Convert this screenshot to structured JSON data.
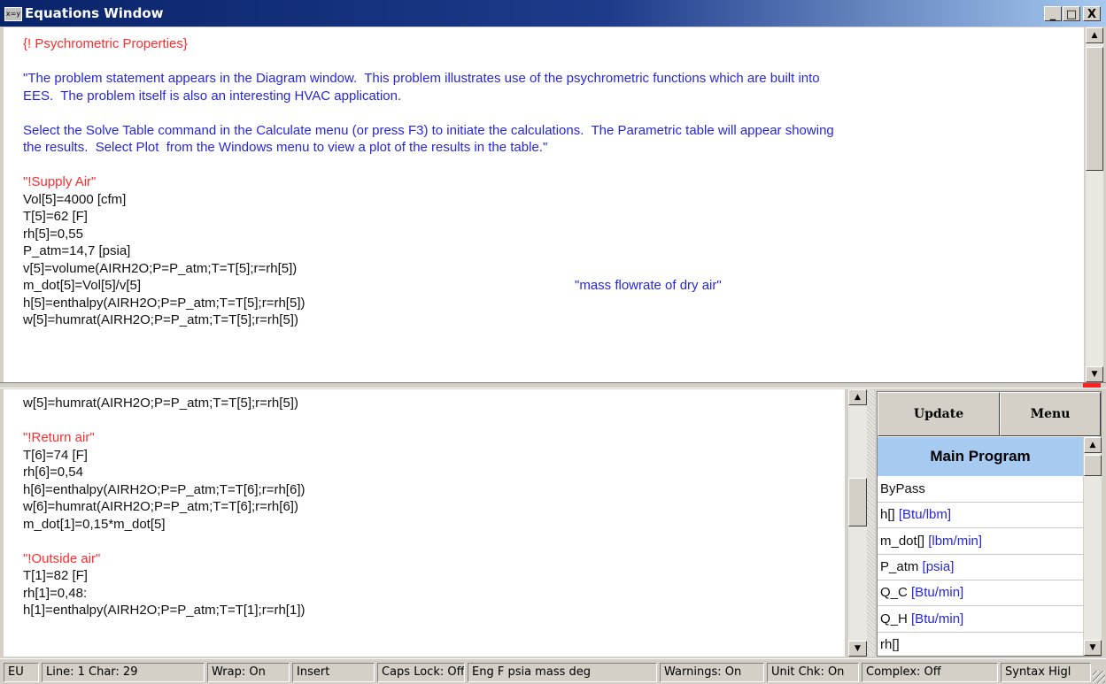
{
  "window": {
    "title": "Equations Window",
    "icon_label": "x=y",
    "controls": {
      "minimize": "_",
      "maximize": "□",
      "close": "X"
    }
  },
  "top_editor": {
    "lines": [
      {
        "text": "{! Psychrometric Properties}",
        "color": "red"
      },
      {
        "text": "",
        "color": "black"
      },
      {
        "text": "\"The problem statement appears in the Diagram window.  This problem illustrates use of the psychrometric functions which are built into",
        "color": "blue"
      },
      {
        "text": "EES.  The problem itself is also an interesting HVAC application.",
        "color": "blue"
      },
      {
        "text": "",
        "color": "black"
      },
      {
        "text": "Select the Solve Table command in the Calculate menu (or press F3) to initiate the calculations.  The Parametric table will appear showing",
        "color": "blue"
      },
      {
        "text": "the results.  Select Plot  from the Windows menu to view a plot of the results in the table.\"",
        "color": "blue"
      },
      {
        "text": "",
        "color": "black"
      },
      {
        "text": "\"!Supply Air\"",
        "color": "red"
      },
      {
        "text": "Vol[5]=4000 [cfm]",
        "color": "black"
      },
      {
        "text": "T[5]=62 [F]",
        "color": "black"
      },
      {
        "text": "rh[5]=0,55",
        "color": "black"
      },
      {
        "text": "P_atm=14,7 [psia]",
        "color": "black"
      },
      {
        "text": "v[5]=volume(AIRH2O;P=P_atm;T=T[5];r=rh[5])",
        "color": "black"
      },
      {
        "text": "m_dot[5]=Vol[5]/v[5]",
        "color": "black",
        "comment": "\"mass flowrate of dry air\""
      },
      {
        "text": "h[5]=enthalpy(AIRH2O;P=P_atm;T=T[5];r=rh[5])",
        "color": "black"
      },
      {
        "text": "w[5]=humrat(AIRH2O;P=P_atm;T=T[5];r=rh[5])",
        "color": "black"
      }
    ]
  },
  "bottom_editor": {
    "lines": [
      {
        "text": "w[5]=humrat(AIRH2O;P=P_atm;T=T[5];r=rh[5])",
        "color": "black"
      },
      {
        "text": "",
        "color": "black"
      },
      {
        "text": "\"!Return air\"",
        "color": "red"
      },
      {
        "text": "T[6]=74 [F]",
        "color": "black"
      },
      {
        "text": "rh[6]=0,54",
        "color": "black"
      },
      {
        "text": "h[6]=enthalpy(AIRH2O;P=P_atm;T=T[6];r=rh[6])",
        "color": "black"
      },
      {
        "text": "w[6]=humrat(AIRH2O;P=P_atm;T=T[6];r=rh[6])",
        "color": "black"
      },
      {
        "text": "m_dot[1]=0,15*m_dot[5]",
        "color": "black"
      },
      {
        "text": "",
        "color": "black"
      },
      {
        "text": "\"!Outside air\"",
        "color": "red"
      },
      {
        "text": "T[1]=82 [F]",
        "color": "black"
      },
      {
        "text": "rh[1]=0,48:",
        "color": "black"
      },
      {
        "text": "h[1]=enthalpy(AIRH2O;P=P_atm;T=T[1];r=rh[1])",
        "color": "black"
      }
    ]
  },
  "right_panel": {
    "update_label": "Update",
    "menu_label": "Menu",
    "header": "Main Program",
    "items": [
      {
        "name": "ByPass",
        "unit": ""
      },
      {
        "name": "h[]",
        "unit": "[Btu/lbm]"
      },
      {
        "name": "m_dot[]",
        "unit": "[lbm/min]"
      },
      {
        "name": "P_atm",
        "unit": "[psia]"
      },
      {
        "name": "Q_C",
        "unit": "[Btu/min]"
      },
      {
        "name": "Q_H",
        "unit": "[Btu/min]"
      },
      {
        "name": "rh[]",
        "unit": ""
      }
    ]
  },
  "status_bar": [
    "EU",
    "Line: 1   Char: 29",
    "Wrap: On",
    "Insert",
    "Caps Lock: Off",
    "Eng F psia mass deg",
    "Warnings: On",
    "Unit Chk: On",
    "Complex: Off",
    "Syntax Higl"
  ],
  "scroll_arrows": {
    "up": "▲",
    "down": "▼"
  },
  "colors": {
    "red": "#ff2d2d",
    "blue": "#2626e0",
    "black": "#111111",
    "header_bg": "#a6caf0",
    "title_bar": "#0a246a"
  }
}
